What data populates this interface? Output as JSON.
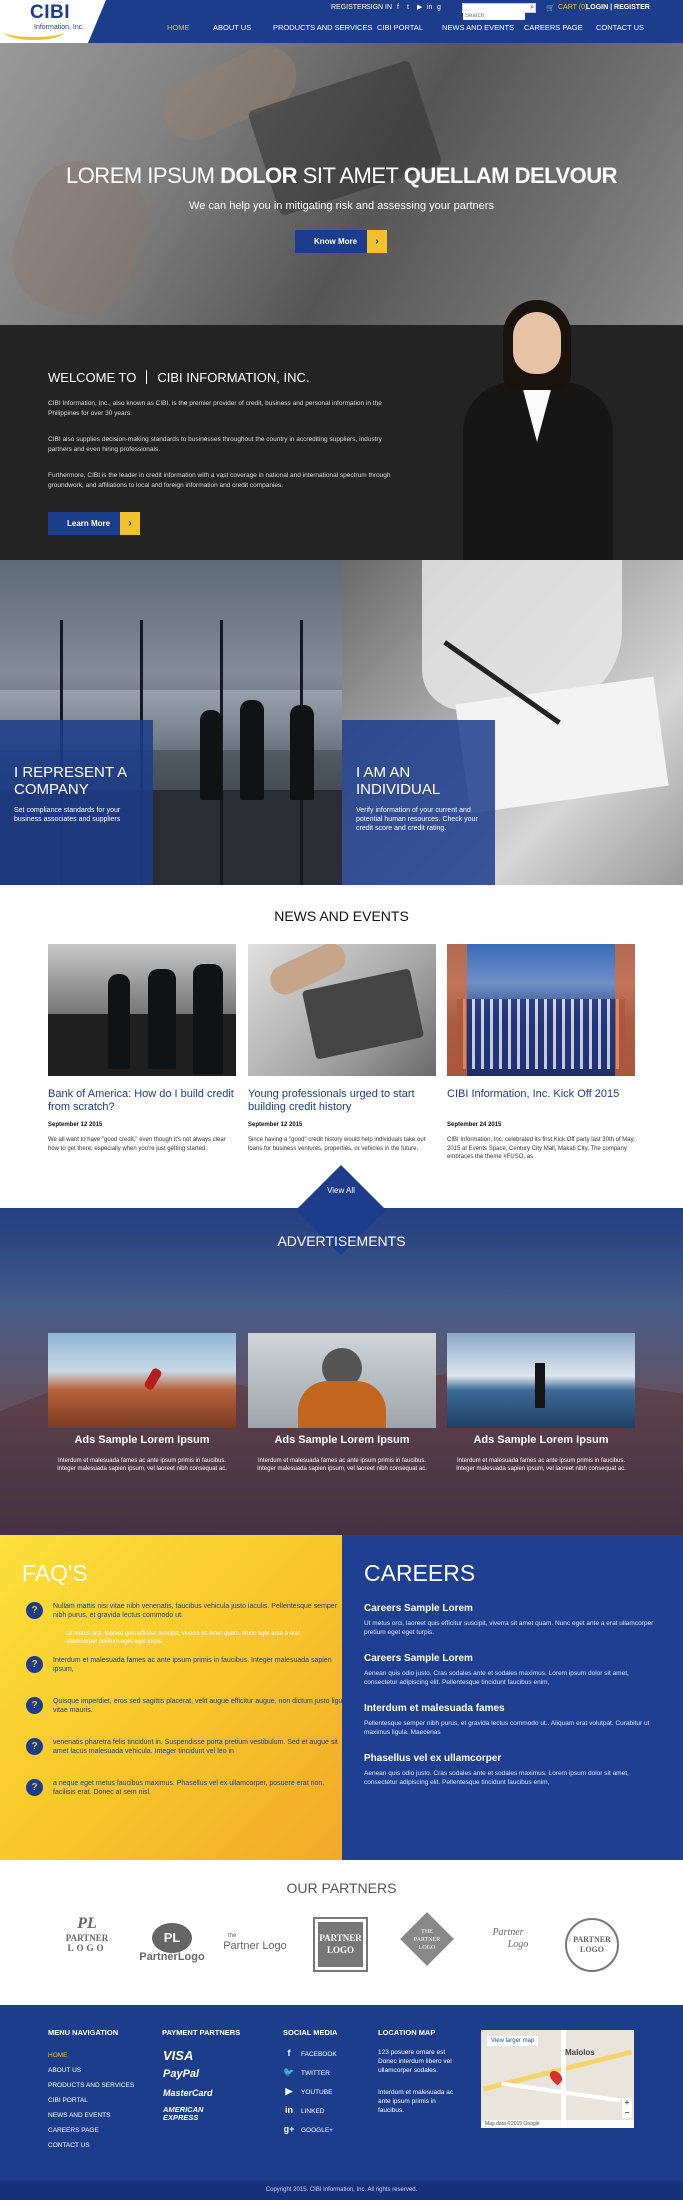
{
  "header": {
    "logo_text": "CIBI",
    "logo_sub": "Information, Inc.",
    "register": "REGISTER",
    "signin": "SIGN IN",
    "search_placeholder": "Search",
    "cart": "CART (0)",
    "login_register": "LOGIN | REGISTER",
    "nav": [
      "HOME",
      "ABOUT US",
      "PRODUCTS AND SERVICES",
      "CIBI PORTAL",
      "NEWS AND EVENTS",
      "CAREERS PAGE",
      "CONTACT US"
    ],
    "social_icons": [
      "facebook-icon",
      "twitter-icon",
      "youtube-icon",
      "linkedin-icon",
      "googleplus-icon"
    ]
  },
  "hero": {
    "title_1": "LOREM IPSUM ",
    "title_2": "DOLOR",
    "title_3": " SIT AMET ",
    "title_4": "QUELLAM DELVOUR",
    "subtitle": "We can help you in mitigating risk and assessing your partners",
    "button": "Know More"
  },
  "welcome": {
    "title_a": "WELCOME TO",
    "title_b": "CIBI INFORMATION, INC.",
    "p1": "CIBI Information, Inc., also known as CIBI, is the premier provider of credit, business and personal information in the Philippines for over 30 years.",
    "p2": "CIBI also supplies decision-making standards to businesses throughout the country in accrediting suppliers, industry partners and even hiring professionals.",
    "p3": "Furthermore, CIBI is the leader in credit information with a vast coverage in national and international spectrum through groundwork, and affiliations to local and foreign information and credit companies.",
    "button": "Learn More"
  },
  "represent": {
    "company_title": "I REPRESENT A COMPANY",
    "company_text": "Set compliance standards for your business associates and suppliers",
    "individual_title": "I AM AN INDIVIDUAL",
    "individual_text": "Verify information of your current and potential human resources. Check your credit score and credit rating."
  },
  "news": {
    "section_title": "NEWS AND EVENTS",
    "items": [
      {
        "title": "Bank of America: How do I build credit from scratch?",
        "date": "September 12 2015",
        "text": "We all want to have \"good credit,\" even though it's not always clear how to get there; especially when you're just getting started."
      },
      {
        "title": "Young professionals urged to start building credit history",
        "date": "September 12 2015",
        "text": "Since having a \"good\" credit history would help individuals take out loans for business ventures, properties, or vehicles in the future,"
      },
      {
        "title": "CIBI Information, Inc. Kick Off 2015",
        "date": "September 24 2015",
        "text": "CIBI Information, Inc. celebrated its first Kick Off party last 30th of May, 2015 at Events Space, Century City Mall, Makati City. The company embraces the theme #FUSO, as"
      }
    ],
    "view_all": "View All"
  },
  "ads": {
    "section_title": "ADVERTISEMENTS",
    "items": [
      {
        "title": "Ads Sample Lorem Ipsum",
        "text": "Interdum et malesuada fames ac ante ipsum primis in faucibus. Integer malesuada sapien ipsum, vel laoreet nibh consequat ac."
      },
      {
        "title": "Ads Sample Lorem Ipsum",
        "text": "Interdum et malesuada fames ac ante ipsum primis in faucibus. Integer malesuada sapien ipsum, vel laoreet nibh consequat ac."
      },
      {
        "title": "Ads Sample Lorem Ipsum",
        "text": "Interdum et malesuada fames ac ante ipsum primis in faucibus. Integer malesuada sapien ipsum, vel laoreet nibh consequat ac."
      }
    ]
  },
  "faq": {
    "title": "FAQ'S",
    "items": [
      {
        "q": "Nullam mattis nisi vitae nibh venenatis, faucibus vehicula justo iaculis. Pellentesque semper nibh purus, et gravida lectus commodo ut.",
        "sub": "Ut metus orci, laoreet quis efficitur suscipit, viverra sit amet quam. Nunc eget ante a erat ullamcorper pretium eget eget turpis."
      },
      {
        "q": "Interdum et malesuada fames ac ante ipsum primis in faucibus. Integer malesuada sapien ipsum,",
        "sub": ""
      },
      {
        "q": "Quisque imperdiet, eros sed sagittis placerat, velit augue efficitur augue, non dictum justo ligula vitae mauris.",
        "sub": ""
      },
      {
        "q": "venenatis pharetra felis tincidunt in. Suspendisse porta pretium vestibulum. Sed et augue sit amet lacus malesuada vehicula. Integer tincidunt vel leo in",
        "sub": ""
      },
      {
        "q": "a neque eget metus faucibus maximus. Phasellus vel ex ullamcorper, posuere erat non, facilisis erat. Donec at sem nisl.",
        "sub": ""
      }
    ]
  },
  "careers": {
    "title": "CAREERS",
    "items": [
      {
        "title": "Careers Sample Lorem",
        "text": "Ut metus orci, laoreet quis efficitur suscipit, viverra sit amet quam. Nunc eget ante a erat ullamcorper pretium eget eget turpis."
      },
      {
        "title": "Careers Sample Lorem",
        "text": "Aenean quis odio justo. Cras sodales ante et sodales maximus. Lorem ipsum dolor sit amet, consectetur adipiscing elit. Pellentesque tincidunt faucibus enim,"
      },
      {
        "title": "Interdum et malesuada fames",
        "text": "Pellentesque semper nibh purus, et gravida lectus commodo ut.. Aliquam erat volutpat. Curabitur ut maximus ligula. Maecenas"
      },
      {
        "title": "Phasellus vel ex ullamcorper",
        "text": "Aenean quis odio justo. Cras sodales ante et sodales maximus. Lorem ipsum dolor sit amet, consectetur adipiscing elit. Pellentesque tincidunt faucibus enim,"
      }
    ]
  },
  "partners": {
    "title": "OUR PARTNERS",
    "logos": [
      "PL PARTNER LOGO",
      "PL PartnerLogo",
      "PartnerLogo",
      "PARTNER LOGO",
      "THE PARTNER LOGO",
      "Partner Logo",
      "PARTNER LOGO"
    ],
    "logo_lines": [
      [
        "PL",
        "PARTNER",
        "LOGO"
      ],
      [
        "PL",
        "PartnerLogo"
      ],
      [
        "the",
        "Partner Logo"
      ],
      [
        "PARTNER",
        "LOGO"
      ],
      [
        "THE",
        "PARTNER",
        "LOGO"
      ],
      [
        "Partner",
        "Logo"
      ],
      [
        "PARTNER",
        "LOGO"
      ]
    ]
  },
  "footer": {
    "menu_title": "MENU NAVIGATION",
    "menu": [
      "HOME",
      "ABOUT US",
      "PRODUCTS AND SERVICES",
      "CIBI PORTAL",
      "NEWS AND EVENTS",
      "CAREERS PAGE",
      "CONTACT US"
    ],
    "payment_title": "PAYMENT PARTNERS",
    "payments": [
      "VISA",
      "PayPal",
      "MasterCard",
      "AMERICAN EXPRESS"
    ],
    "social_title": "SOCIAL MEDIA",
    "social": [
      "FACEBOOK",
      "TWITTER",
      "YOUTUBE",
      "LINKED",
      "GOOGLE+"
    ],
    "location_title": "LOCATION MAP",
    "address": "123 posuere ornare est Donec interdum libero vel ullamcorper sodales.",
    "address2": "Interdum et malesuada ac ante ipsum primis in faucibus.",
    "map_link": "View larger map",
    "map_label": "Malolos",
    "map_footer": "Map data ©2015 Google",
    "copyright": "Copyright 2015. CIBI Information, Inc. All rights reserved."
  },
  "colors": {
    "brand_blue": "#1c3c8c",
    "accent_yellow": "#f2c12e"
  }
}
